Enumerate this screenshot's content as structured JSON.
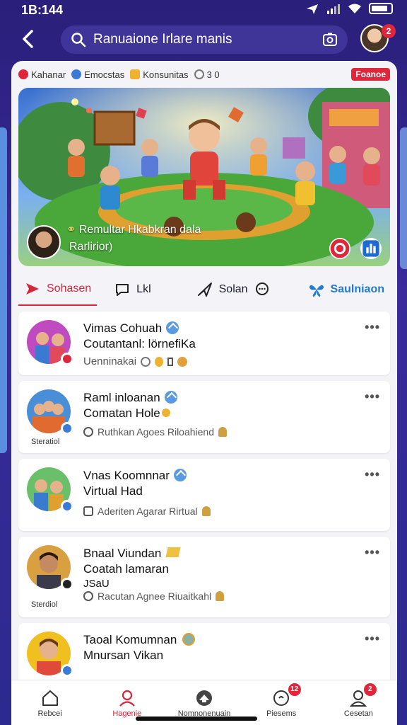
{
  "status_bar": {
    "time": "1B:144"
  },
  "header": {
    "search_text": "Ranuaione Irlare manis",
    "avatar_badge": "2"
  },
  "chips": [
    {
      "label": "Kahanar",
      "color": "#e0263a"
    },
    {
      "label": "Emocstas",
      "color": "#3b7ad6"
    },
    {
      "label": "Konsunitas",
      "color": "#f0b030"
    },
    {
      "label": "3 0",
      "color": "#777777"
    }
  ],
  "chip_badge": "Foanoe",
  "banner": {
    "title": "Remultar Hkabkran dala",
    "subtitle": "Rarlirior)"
  },
  "tabs": [
    {
      "label": "Sohasen",
      "icon": "play-icon"
    },
    {
      "label": "Lkl",
      "icon": "comment-icon"
    },
    {
      "label": "Solan",
      "icon": "share-icon"
    },
    {
      "label": "Saulniaon",
      "icon": "butterfly-icon"
    }
  ],
  "list": [
    {
      "title": "Vimas Cohuah",
      "subtitle": "Coutantanl: lörnefiKa",
      "subtitle2": "",
      "meta": "Uenninakai",
      "under_label": "",
      "avatar_bg": "#c04ac0"
    },
    {
      "title": "Raml inloanan",
      "subtitle": "Comatan Hole",
      "subtitle2": "",
      "meta": "Ruthkan Agoes Riloahiend",
      "under_label": "Steratiol",
      "avatar_bg": "#4a8ed8"
    },
    {
      "title": "Vnas Koomnnar",
      "subtitle": "Virtual Had",
      "subtitle2": "",
      "meta": "Aderiten Agarar Rirtual",
      "under_label": "",
      "avatar_bg": "#6ac06a"
    },
    {
      "title": "Bnaal Viundan",
      "subtitle": "Coatah lamaran",
      "subtitle2": "JSaU",
      "meta": "Racutan Agnee Riuaitkahl",
      "under_label": "Sterdiol",
      "avatar_bg": "#d8a040"
    },
    {
      "title": "Taoal Komumnan",
      "subtitle": "Mnursan Vikan",
      "subtitle2": "",
      "meta": "",
      "under_label": "",
      "avatar_bg": "#f0c020"
    }
  ],
  "bottom_nav": [
    {
      "label": "Rebcei",
      "icon": "home-icon",
      "badge": ""
    },
    {
      "label": "Hagenie",
      "icon": "profile-icon",
      "badge": ""
    },
    {
      "label": "Nomnonenuain",
      "icon": "community-icon",
      "badge": ""
    },
    {
      "label": "Piesems",
      "icon": "chat-icon",
      "badge": "12"
    },
    {
      "label": "Cesetan",
      "icon": "user-icon",
      "badge": "2"
    }
  ]
}
